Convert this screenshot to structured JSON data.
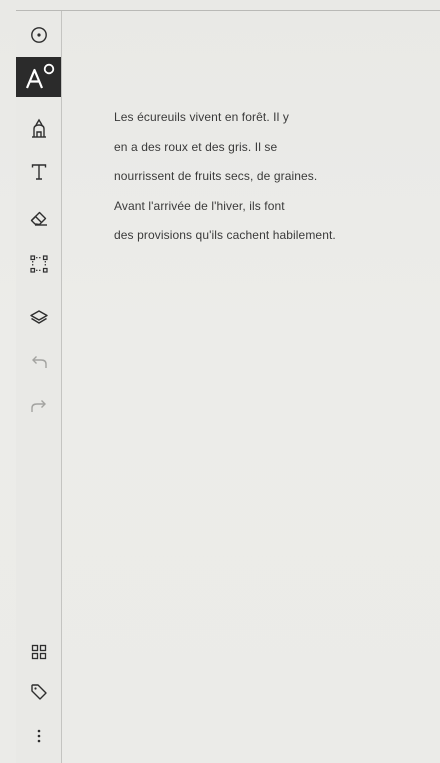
{
  "toolbar": {
    "items": [
      {
        "name": "pen-tool-button",
        "icon": "pen-tip-icon",
        "active": false
      },
      {
        "name": "handwriting-to-text-button",
        "icon": "text-conversion-icon",
        "active": true
      },
      {
        "name": "highlighter-button",
        "icon": "highlighter-icon",
        "active": false
      },
      {
        "name": "text-tool-button",
        "icon": "text-t-icon",
        "active": false
      },
      {
        "name": "eraser-button",
        "icon": "eraser-icon",
        "active": false
      },
      {
        "name": "lasso-select-button",
        "icon": "selection-icon",
        "active": false
      },
      {
        "name": "layers-button",
        "icon": "layers-icon",
        "active": false
      },
      {
        "name": "undo-button",
        "icon": "undo-icon",
        "active": false
      },
      {
        "name": "redo-button",
        "icon": "redo-icon",
        "active": false
      },
      {
        "name": "page-overview-button",
        "icon": "grid-icon",
        "active": false
      },
      {
        "name": "tags-button",
        "icon": "tag-icon",
        "active": false
      },
      {
        "name": "more-options-button",
        "icon": "more-vertical-icon",
        "active": false
      }
    ],
    "active_accent": "#2b2b2b",
    "disabled_color": "#a3a3a0"
  },
  "document": {
    "lines": [
      "Les écureuils vivent en forêt. Il y",
      "en a des roux et des gris. Il se",
      "nourrissent de fruits secs, de graines.",
      "Avant l'arrivée de l'hiver, ils font",
      "des provisions qu'ils cachent habilement."
    ]
  }
}
